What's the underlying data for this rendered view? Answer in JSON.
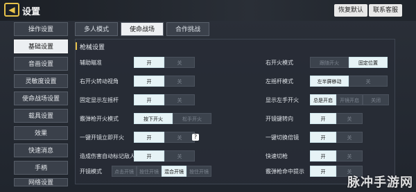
{
  "header": {
    "back_icon": "back-arrow-icon",
    "title": "设置",
    "reset_label": "恢复默认",
    "support_label": "联系客服"
  },
  "sidebar": {
    "items": [
      {
        "label": "操作设置"
      },
      {
        "label": "基础设置",
        "active": true
      },
      {
        "label": "音画设置"
      },
      {
        "label": "灵敏度设置"
      },
      {
        "label": "使命战场设置"
      },
      {
        "label": "载具设置"
      },
      {
        "label": "效果"
      },
      {
        "label": "快速消息"
      },
      {
        "label": "手柄"
      },
      {
        "label": "网络设置"
      }
    ]
  },
  "tabs": [
    {
      "label": "多人模式"
    },
    {
      "label": "使命战场",
      "active": true
    },
    {
      "label": "合作挑战"
    }
  ],
  "main": {
    "section_title": "枪械设置",
    "left_rows": [
      {
        "label": "辅助瞄准",
        "options": [
          "开",
          "关"
        ],
        "selected": 0
      },
      {
        "label": "右开火转动视角",
        "options": [
          "开",
          "关"
        ],
        "selected": 0
      },
      {
        "label": "固定显示左摇杆",
        "options": [
          "开",
          "关"
        ],
        "selected": 0
      },
      {
        "label": "霰弹枪开火模式",
        "options": [
          "按下开火",
          "松手开火"
        ],
        "selected": 0
      },
      {
        "label": "一键开镜立即开火",
        "options": [
          "开",
          "关"
        ],
        "selected": 0,
        "help": "?"
      },
      {
        "label": "造成伤害自动标记敌人",
        "options": [
          "开",
          "关"
        ],
        "selected": 0
      },
      {
        "label": "开镜模式",
        "options": [
          "点击开镜",
          "按住开镜",
          "混合开镜",
          "按住开镜"
        ],
        "selected": 2
      }
    ],
    "right_rows": [
      {
        "label": "右开火模式",
        "options": [
          "跟随开火",
          "固定位置"
        ],
        "selected": 1
      },
      {
        "label": "左摇杆模式",
        "options": [
          "左半屏移动",
          "关"
        ],
        "selected": 0
      },
      {
        "label": "显示左手开火",
        "options": [
          "总是开启",
          "开镜开启",
          "关闭"
        ],
        "selected": 0
      },
      {
        "label": "开镜键转向",
        "options": [
          "开",
          "关"
        ],
        "selected": 0
      },
      {
        "label": "一键切换倍镜",
        "options": [
          "开",
          "关"
        ],
        "selected": 0
      },
      {
        "label": "快速切枪",
        "options": [
          "开",
          "关"
        ],
        "selected": 0
      },
      {
        "label": "霰弹枪命中提示",
        "options": [
          "开",
          "关"
        ],
        "selected": 0
      }
    ]
  },
  "watermark": "脉冲手游网"
}
